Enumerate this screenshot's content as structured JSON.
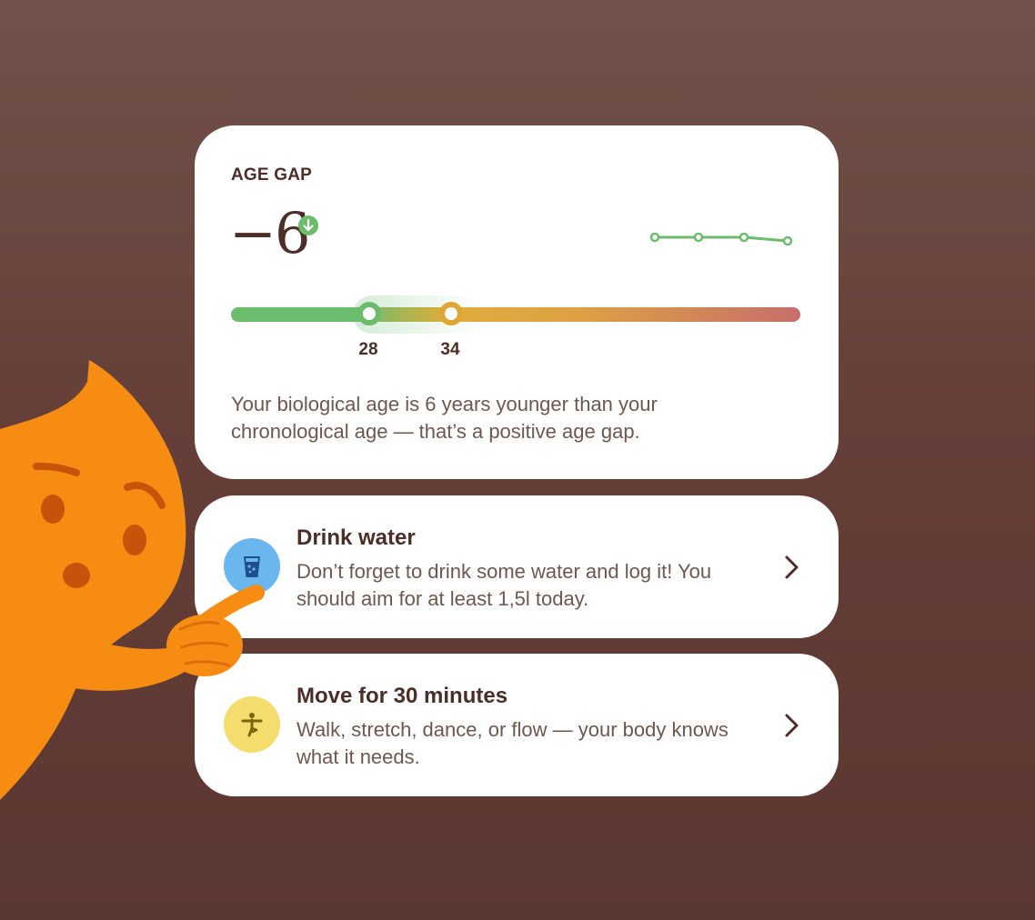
{
  "age_gap": {
    "label": "AGE GAP",
    "value": "−6",
    "trend_icon": "arrow-down-icon",
    "biological_age": "28",
    "chronological_age": "34",
    "description": "Your biological age is 6 years younger than your chronological age — that’s a positive age gap."
  },
  "tasks": [
    {
      "title": "Drink water",
      "text": "Don’t forget to drink some water and log it! You should aim for at least 1,5l today.",
      "icon": "water-glass-icon"
    },
    {
      "title": "Move for 30 minutes",
      "text": "Walk, stretch, dance, or flow — your body knows what it needs.",
      "icon": "stretching-person-icon"
    }
  ],
  "colors": {
    "background": "#653f38",
    "green": "#6cbc6e",
    "orange": "#dfa535",
    "red": "#c76e6b",
    "text_dark": "#4c2d27",
    "text_muted": "#6e5751",
    "water_icon_bg": "#69b7ee",
    "move_icon_bg": "#f4dd6c",
    "mascot": "#f68d12"
  }
}
